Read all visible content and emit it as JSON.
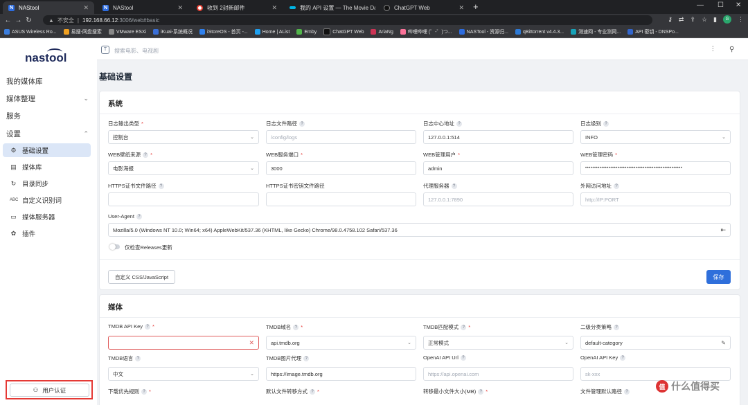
{
  "browser": {
    "tabs": [
      {
        "label": "NAStool",
        "icon": "nastool-favicon"
      },
      {
        "label": "NAStool",
        "icon": "nastool-favicon"
      },
      {
        "label": "收到 2封新邮件",
        "icon": "gmail-favicon"
      },
      {
        "label": "我的 API 设置 — The Movie Da",
        "icon": "tmdb-favicon"
      },
      {
        "label": "ChatGPT Web",
        "icon": "chatgpt-favicon"
      }
    ],
    "url_warning": "不安全",
    "url_host": "192.168.66.12",
    "url_path": ":3006/web#basic",
    "profile_initial": "G",
    "bookmarks": [
      {
        "label": "ASUS Wireless Ro...",
        "color": "#3b7ddd"
      },
      {
        "label": "易搜-网盘搜索",
        "color": "#f0a020"
      },
      {
        "label": "VMware ESXi",
        "color": "#888888"
      },
      {
        "label": "iKuai-系统概况",
        "color": "#3a6fd8"
      },
      {
        "label": "iStoreOS - 首页 -...",
        "color": "#2f80ed"
      },
      {
        "label": "Home | AList",
        "color": "#1ea0f0"
      },
      {
        "label": "Emby",
        "color": "#52b54b"
      },
      {
        "label": "ChatGPT Web",
        "color": "#111111"
      },
      {
        "label": "AriaNg",
        "color": "#cc3355"
      },
      {
        "label": "哔哩哔哩 (゜-゜)つ...",
        "color": "#fb7299"
      },
      {
        "label": "NASTool - 资源归...",
        "color": "#2d6cdf"
      },
      {
        "label": "qBittorrent v4.4.3...",
        "color": "#2d7ad6"
      },
      {
        "label": "测速网 - 专业测网...",
        "color": "#17a2b8"
      },
      {
        "label": "API 密钥 - DNSPo...",
        "color": "#3366cc"
      }
    ]
  },
  "sidebar": {
    "logo": "nastool",
    "items": [
      {
        "label": "我的媒体库"
      },
      {
        "label": "媒体整理"
      },
      {
        "label": "服务"
      },
      {
        "label": "设置"
      }
    ],
    "settings_sub": [
      {
        "label": "基础设置",
        "icon": "gear-icon"
      },
      {
        "label": "媒体库",
        "icon": "library-icon"
      },
      {
        "label": "目录同步",
        "icon": "sync-icon"
      },
      {
        "label": "自定义识别词",
        "icon": "abc-icon"
      },
      {
        "label": "媒体服务器",
        "icon": "server-icon"
      },
      {
        "label": "插件",
        "icon": "plugin-icon"
      }
    ],
    "auth_button": "用户认证"
  },
  "topbar": {
    "search_placeholder": "搜索电影、电视剧"
  },
  "page": {
    "title": "基础设置"
  },
  "system": {
    "title": "系统",
    "fields": [
      {
        "label": "日志输出类型",
        "value": "控制台",
        "required": true,
        "help": false,
        "kind": "select"
      },
      {
        "label": "日志文件路径",
        "value": "/config/logs",
        "required": false,
        "help": true,
        "kind": "placeholder"
      },
      {
        "label": "日志中心地址",
        "value": "127.0.0.1:514",
        "required": false,
        "help": true,
        "kind": "text"
      },
      {
        "label": "日志级别",
        "value": "INFO",
        "required": false,
        "help": true,
        "kind": "select"
      },
      {
        "label": "WEB壁纸来源",
        "value": "电影海报",
        "required": true,
        "help": true,
        "kind": "select"
      },
      {
        "label": "WEB服务端口",
        "value": "3000",
        "required": true,
        "help": false,
        "kind": "text"
      },
      {
        "label": "WEB管理用户",
        "value": "admin",
        "required": true,
        "help": false,
        "kind": "text"
      },
      {
        "label": "WEB管理密码",
        "value": "••••••••••••••••••••••••••••••••••••••••••••••••••••••",
        "required": true,
        "help": false,
        "kind": "text"
      },
      {
        "label": "HTTPS证书文件路径",
        "value": "",
        "required": false,
        "help": true,
        "kind": "text"
      },
      {
        "label": "HTTPS证书密钥文件路径",
        "value": "",
        "required": false,
        "help": false,
        "kind": "text"
      },
      {
        "label": "代理服务器",
        "value": "127.0.0.1:7890",
        "required": false,
        "help": true,
        "kind": "placeholder"
      },
      {
        "label": "外网访问地址",
        "value": "http://IP:PORT",
        "required": false,
        "help": true,
        "kind": "placeholder"
      }
    ],
    "user_agent_label": "User-Agent",
    "user_agent_value": "Mozilla/5.0 (Windows NT 10.0; Win64; x64) AppleWebKit/537.36 (KHTML, like Gecko) Chrome/98.0.4758.102 Safari/537.36",
    "releases_toggle_label": "仅检查Releases更新",
    "custom_css_button": "自定义 CSS/JavaScript",
    "save_button": "保存"
  },
  "media": {
    "title": "媒体",
    "fields": [
      {
        "label": "TMDB API Key",
        "value": "",
        "required": true,
        "help": true,
        "kind": "error"
      },
      {
        "label": "TMDB域名",
        "value": "api.tmdb.org",
        "required": true,
        "help": true,
        "kind": "select"
      },
      {
        "label": "TMDB匹配模式",
        "value": "正常模式",
        "required": true,
        "help": true,
        "kind": "select"
      },
      {
        "label": "二级分类策略",
        "value": "default-category",
        "required": false,
        "help": true,
        "kind": "edit"
      },
      {
        "label": "TMDB语言",
        "value": "中文",
        "required": false,
        "help": true,
        "kind": "select"
      },
      {
        "label": "TMDB图片代理",
        "value": "https://image.tmdb.org",
        "required": false,
        "help": true,
        "kind": "text"
      },
      {
        "label": "OpenAI API Url",
        "value": "https://api.openai.com",
        "required": false,
        "help": true,
        "kind": "placeholder"
      },
      {
        "label": "OpenAI API Key",
        "value": "sk-xxx",
        "required": false,
        "help": true,
        "kind": "placeholder"
      },
      {
        "label": "下载优先规则",
        "value": "",
        "required": true,
        "help": true,
        "kind": "label-only"
      },
      {
        "label": "默认文件转移方式",
        "value": "",
        "required": true,
        "help": true,
        "kind": "label-only"
      },
      {
        "label": "转移最小文件大小(MB)",
        "value": "",
        "required": true,
        "help": true,
        "kind": "label-only"
      },
      {
        "label": "文件管理默认路径",
        "value": "",
        "required": false,
        "help": true,
        "kind": "label-only"
      }
    ]
  },
  "watermark": {
    "badge": "值",
    "text": "什么值得买"
  }
}
